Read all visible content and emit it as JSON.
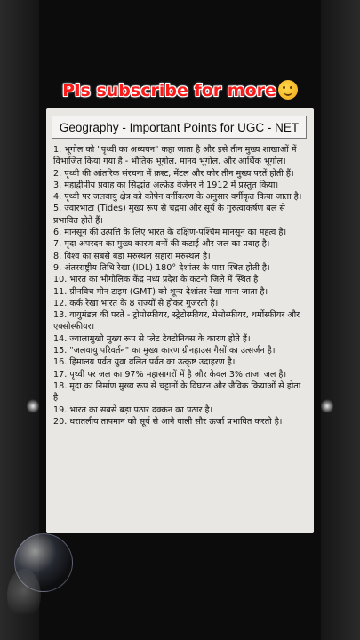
{
  "banner": {
    "text": "Pls subscribe for more",
    "emoji_icon": "hugging-face-emoji"
  },
  "card": {
    "title": "Geography - Important Points for UGC - NET",
    "points": [
      "1. भूगोल को \"पृथ्वी का अध्ययन\" कहा जाता है और इसे तीन मुख्य शाखाओं में विभाजित किया गया है - भौतिक भूगोल, मानव भूगोल, और आर्थिक भूगोल।",
      "2. पृथ्वी की आंतरिक संरचना में क्रस्ट, मेंटल और कोर तीन मुख्य परतें होती हैं।",
      "3. महाद्वीपीय प्रवाह का सिद्धांत अल्फ्रेड वेजेनर ने 1912 में प्रस्तुत किया।",
      "4. पृथ्वी पर जलवायु क्षेत्र को कोपेन वर्गीकरण के अनुसार वर्गीकृत किया जाता है।",
      "5. ज्वारभाटा (Tides) मुख्य रूप से चंद्रमा और सूर्य के गुरुत्वाकर्षण बल से प्रभावित होते हैं।",
      "6. मानसून की उत्पत्ति के लिए भारत के दक्षिण-पश्चिम मानसून का महत्व है।",
      "7. मृदा अपरदन का मुख्य कारण वनों की कटाई और जल का प्रवाह है।",
      "8. विश्व का सबसे बड़ा मरुस्थल सहारा मरुस्थल है।",
      "9. अंतरराष्ट्रीय तिथि रेखा (IDL) 180° देशांतर के पास स्थित होती है।",
      "10. भारत का भौगोलिक केंद्र मध्य प्रदेश के कटनी जिले में स्थित है।",
      "11. ग्रीनविच मीन टाइम (GMT) को शून्य देशांतर रेखा माना जाता है।",
      "12. कर्क रेखा भारत के 8 राज्यों से होकर गुजरती है।",
      "13. वायुमंडल की परतें - ट्रोपोस्फीयर, स्ट्रेटोस्फीयर, मेसोस्फीयर, थर्मोस्फीयर और एक्सोस्फीयर।",
      "14. ज्वालामुखी मुख्य रूप से प्लेट टेक्टोनिक्स के कारण होते हैं।",
      "15. \"जलवायु परिवर्तन\" का मुख्य कारण ग्रीनहाउस गैसों का उत्सर्जन है।",
      "16. हिमालय पर्वत युवा वलित पर्वत का उत्कृष्ट उदाहरण है।",
      "17. पृथ्वी पर जल का 97% महासागरों में है और केवल 3% ताजा जल है।",
      "18. मृदा का निर्माण मुख्य रूप से चट्टानों के विघटन और जैविक क्रियाओं से होता है।",
      "19. भारत का सबसे बड़ा पठार दक्कन का पठार है।",
      "20. धरातलीय तापमान को सूर्य से आने वाली सौर ऊर्जा प्रभावित करती है।"
    ]
  },
  "colors": {
    "banner": "#ff1a1a",
    "card_bg": "#e9e7e4",
    "page_bg": "#111111"
  }
}
